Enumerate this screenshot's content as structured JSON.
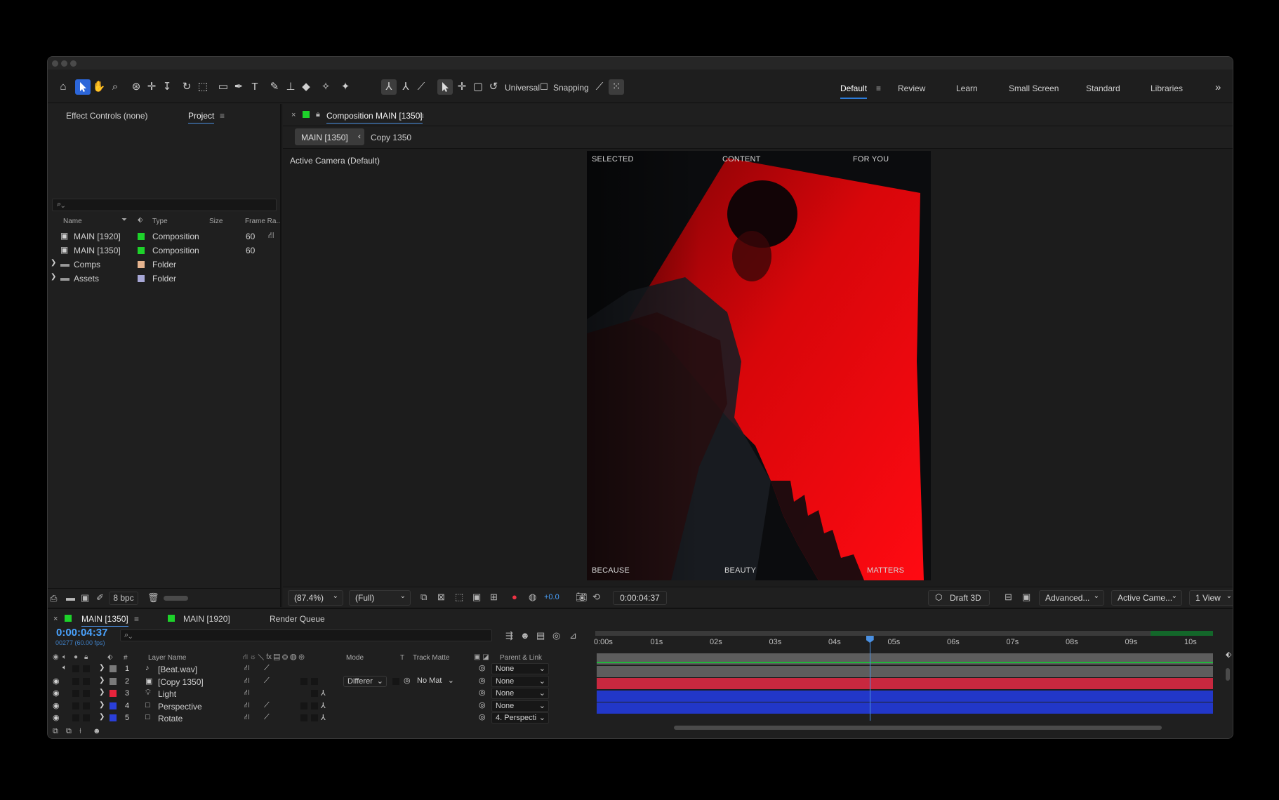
{
  "toolbar": {
    "universal_label": "Universal",
    "snapping_label": "Snapping",
    "workspaces": [
      "Default",
      "Review",
      "Learn",
      "Small Screen",
      "Standard",
      "Libraries"
    ],
    "overflow": "»"
  },
  "left_panel": {
    "tabs": [
      "Effect Controls (none)",
      "Project"
    ],
    "search_placeholder": "",
    "columns": [
      "Name",
      "Type",
      "Size",
      "Frame Ra.."
    ],
    "items": [
      {
        "name": "MAIN [1920]",
        "type": "Composition",
        "frame_rate": "60",
        "color": "#1dd22a",
        "kind": "comp"
      },
      {
        "name": "MAIN [1350]",
        "type": "Composition",
        "frame_rate": "60",
        "color": "#1dd22a",
        "kind": "comp"
      },
      {
        "name": "Comps",
        "type": "Folder",
        "frame_rate": "",
        "color": "#e6b48f",
        "kind": "folder"
      },
      {
        "name": "Assets",
        "type": "Folder",
        "frame_rate": "",
        "color": "#a7a7d6",
        "kind": "folder"
      }
    ],
    "bpc": "8 bpc"
  },
  "comp_panel": {
    "tab_title": "Composition MAIN [1350]",
    "breadcrumbs": [
      "MAIN [1350]",
      "Copy 1350"
    ],
    "camera_label": "Active Camera (Default)",
    "poster_text": {
      "top": [
        "SELECTED",
        "CONTENT",
        "FOR YOU"
      ],
      "bottom": [
        "BECAUSE",
        "BEAUTY",
        "MATTERS"
      ]
    },
    "footer": {
      "zoom": "(87.4%)",
      "resolution": "(Full)",
      "exposure": "+0.0",
      "timecode": "0:00:04:37",
      "renderer": "Draft 3D",
      "advanced": "Advanced...",
      "camera": "Active Came...",
      "views": "1 View"
    }
  },
  "timeline": {
    "tabs": [
      "MAIN [1350]",
      "MAIN [1920]",
      "Render Queue"
    ],
    "timecode": "0:00:04:37",
    "frame_info": "00277 (60.00 fps)",
    "col_headers": {
      "num": "#",
      "layer_name": "Layer Name",
      "mode": "Mode",
      "t": "T",
      "track_matte": "Track Matte",
      "parent": "Parent & Link"
    },
    "ruler": [
      "0:00s",
      "01s",
      "02s",
      "03s",
      "04s",
      "05s",
      "06s",
      "07s",
      "08s",
      "09s",
      "10s"
    ],
    "playhead_seconds": 4.6,
    "layers": [
      {
        "num": "1",
        "name": "[Beat.wav]",
        "label_color": "#7a7a7a",
        "mode": "",
        "track_matte": "",
        "parent": "None",
        "bar_color": "#5d5d5d",
        "icon": "audio"
      },
      {
        "num": "2",
        "name": "[Copy 1350]",
        "label_color": "#7a7a7a",
        "mode": "Differer",
        "track_matte": "No Mat",
        "parent": "None",
        "bar_color": "#5d5d5d",
        "icon": "comp"
      },
      {
        "num": "3",
        "name": "Light",
        "label_color": "#e8243c",
        "mode": "",
        "track_matte": "",
        "parent": "None",
        "bar_color": "#c8283f",
        "icon": "light"
      },
      {
        "num": "4",
        "name": "Perspective",
        "label_color": "#2a3fd9",
        "mode": "",
        "track_matte": "",
        "parent": "None",
        "bar_color": "#2237c8",
        "icon": "null"
      },
      {
        "num": "5",
        "name": "Rotate",
        "label_color": "#2a3fd9",
        "mode": "",
        "track_matte": "",
        "parent": "4. Perspecti",
        "bar_color": "#2237c8",
        "icon": "null"
      }
    ]
  }
}
